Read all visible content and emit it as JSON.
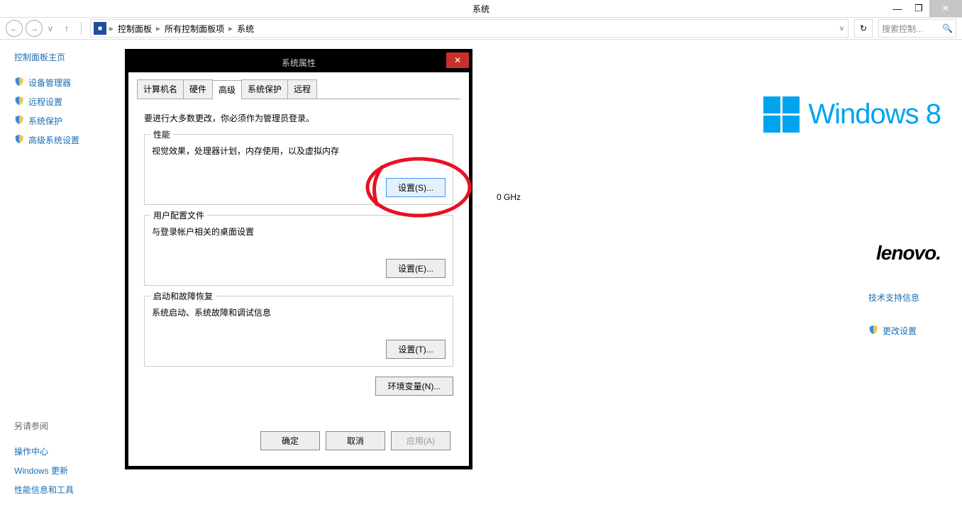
{
  "titlebar": {
    "title": "系统"
  },
  "win_controls": {
    "min": "—",
    "max": "❐",
    "close": "✕"
  },
  "toolbar": {
    "back_glyph": "←",
    "forward_glyph": "→",
    "up_glyph": "↑",
    "dropdown": "v",
    "refresh": "↻",
    "breadcrumb": [
      "控制面板",
      "所有控制面板项",
      "系统"
    ],
    "crumb_sep": "▸",
    "search_placeholder": "搜索控制...",
    "search_icon": "🔍"
  },
  "sidebar": {
    "title": "控制面板主页",
    "links": [
      {
        "label": "设备管理器",
        "shield": true
      },
      {
        "label": "远程设置",
        "shield": true
      },
      {
        "label": "系统保护",
        "shield": true
      },
      {
        "label": "高级系统设置",
        "shield": true
      }
    ],
    "see_also_title": "另请参阅",
    "see_also": [
      "操作中心",
      "Windows 更新",
      "性能信息和工具"
    ]
  },
  "content": {
    "windows8": "Windows 8",
    "oem": "lenovo.",
    "ghz_fragment": "0 GHz",
    "right_links": {
      "support": "技术支持信息",
      "change": "更改设置"
    }
  },
  "dialog": {
    "title": "系统属性",
    "close": "✕",
    "tabs": [
      "计算机名",
      "硬件",
      "高级",
      "系统保护",
      "远程"
    ],
    "active_tab_index": 2,
    "admin_note": "要进行大多数更改，你必须作为管理员登录。",
    "groups": {
      "perf": {
        "title": "性能",
        "desc": "视觉效果，处理器计划，内存使用，以及虚拟内存",
        "btn": "设置(S)..."
      },
      "profile": {
        "title": "用户配置文件",
        "desc": "与登录帐户相关的桌面设置",
        "btn": "设置(E)..."
      },
      "startup": {
        "title": "启动和故障恢复",
        "desc": "系统启动、系统故障和调试信息",
        "btn": "设置(T)..."
      }
    },
    "env_btn": "环境变量(N)...",
    "buttons": {
      "ok": "确定",
      "cancel": "取消",
      "apply": "应用(A)"
    }
  }
}
